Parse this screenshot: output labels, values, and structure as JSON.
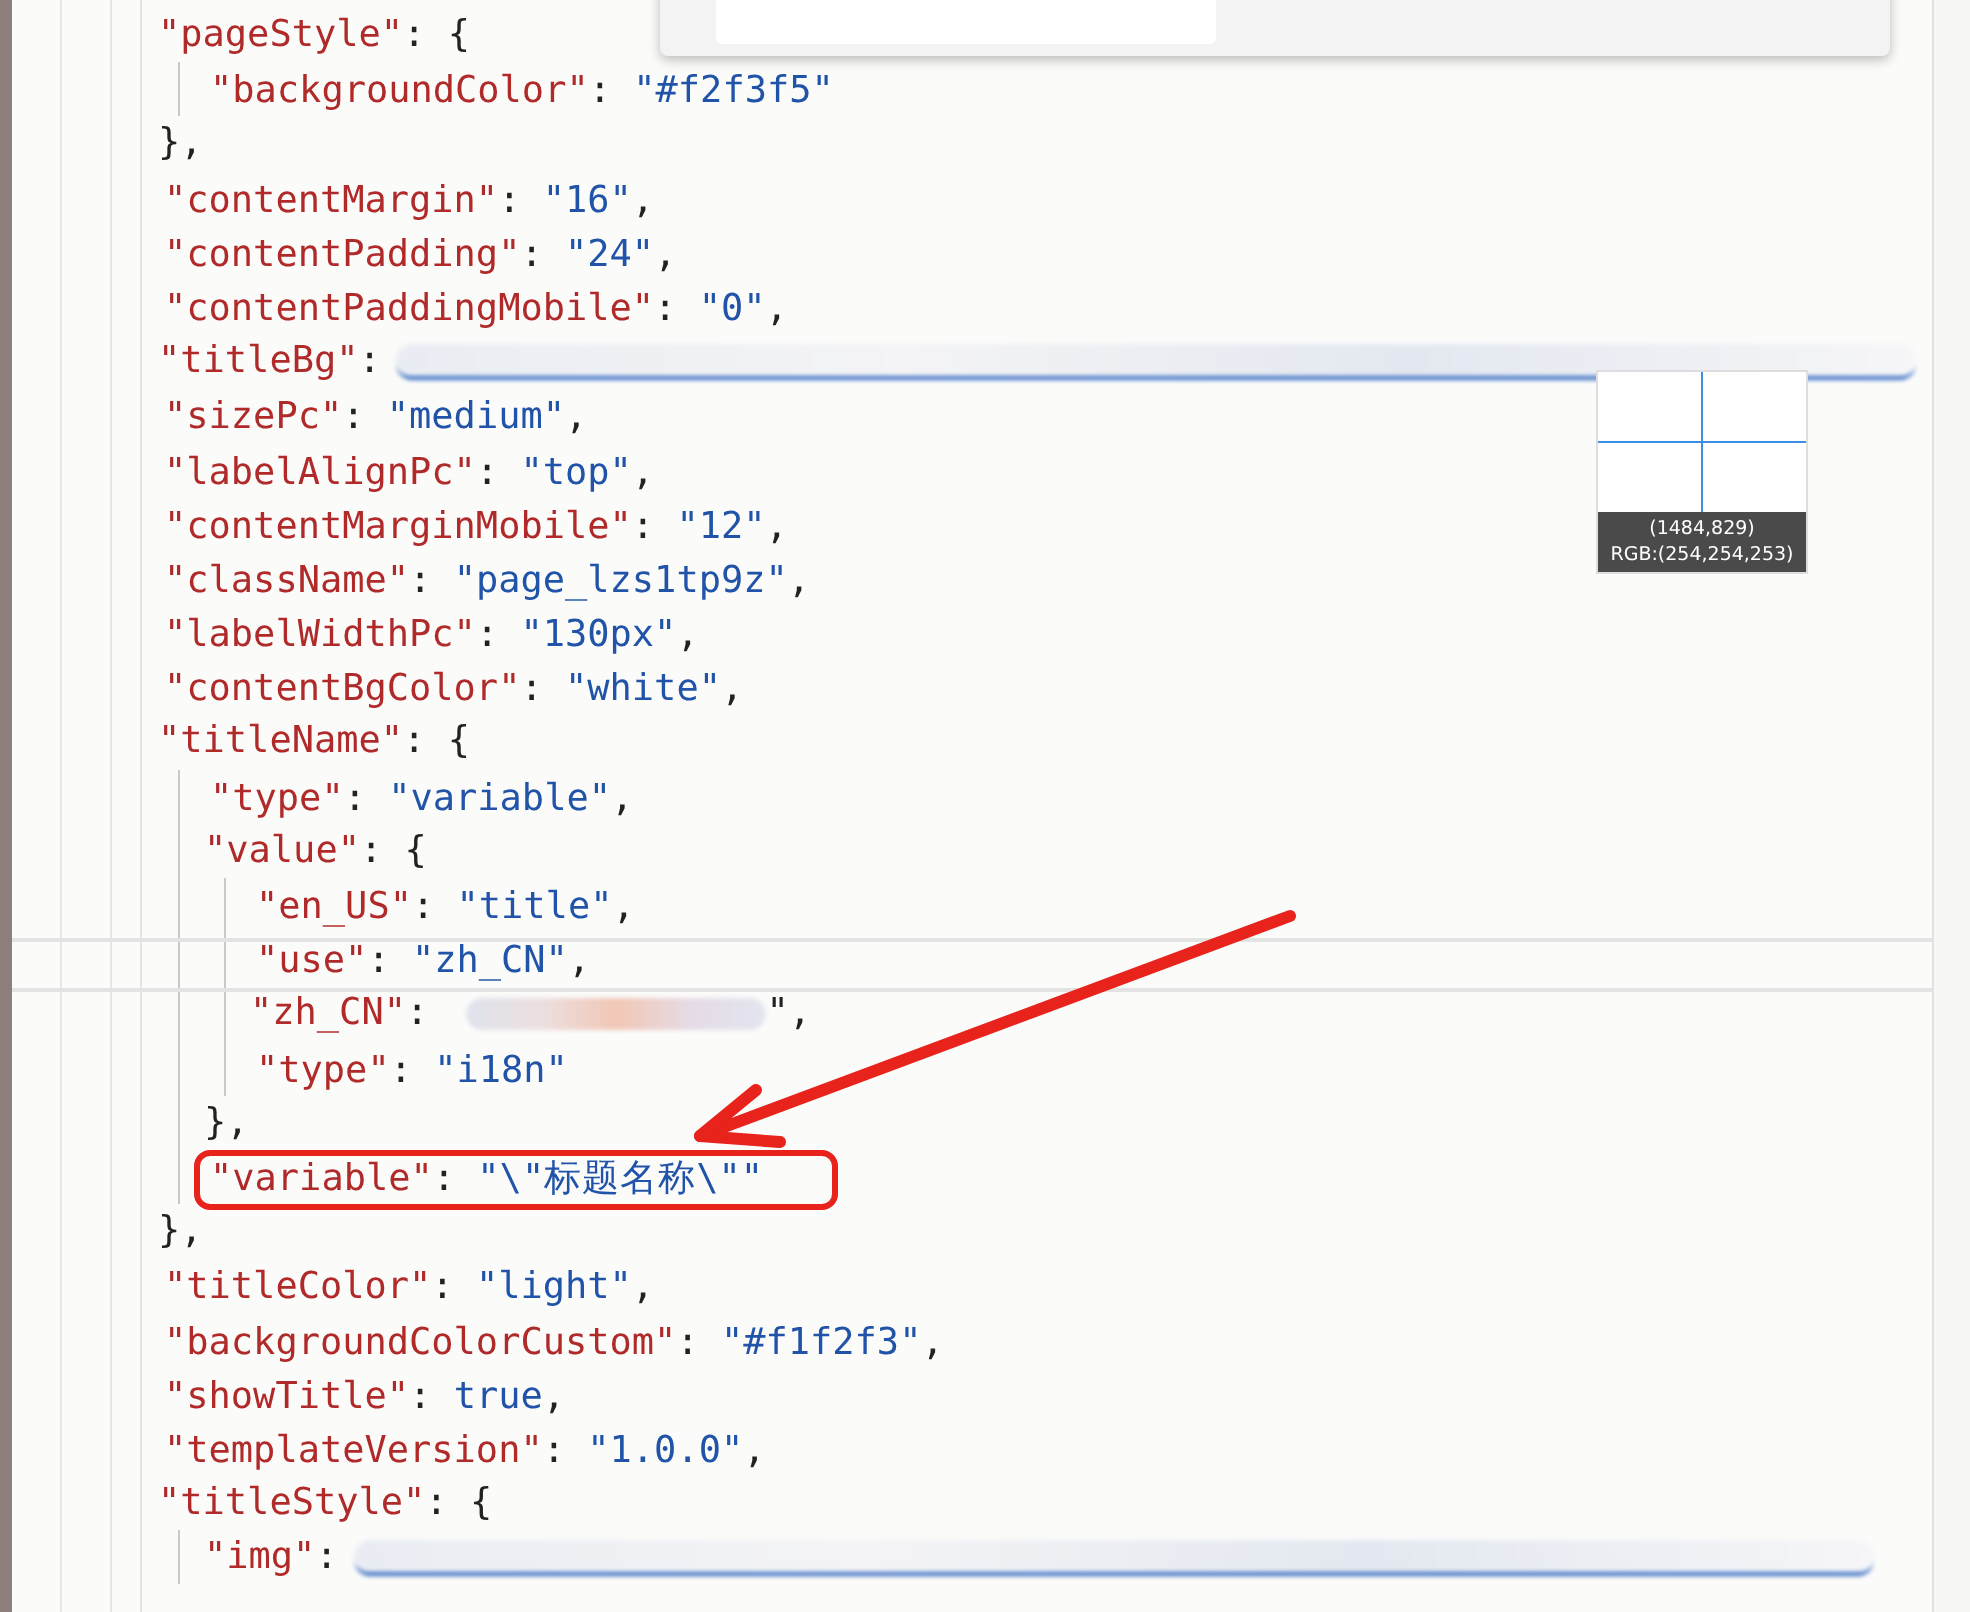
{
  "editor": {
    "lines": [
      {
        "kind": "object",
        "key": "\"pageStyle\"",
        "sep": ": ",
        "open": "{",
        "close": "},",
        "children": [
          {
            "kind": "pair",
            "key": "\"backgroundColor\"",
            "sep": ": ",
            "value": "\"#f2f3f5\""
          }
        ]
      },
      {
        "kind": "pair",
        "key": "\"contentMargin\"",
        "sep": ": ",
        "value": "\"16\"",
        "tail": ","
      },
      {
        "kind": "pair",
        "key": "\"contentPadding\"",
        "sep": ": ",
        "value": "\"24\"",
        "tail": ","
      },
      {
        "kind": "pair",
        "key": "\"contentPaddingMobile\"",
        "sep": ": ",
        "value": "\"0\"",
        "tail": ","
      },
      {
        "kind": "redacted",
        "key": "\"titleBg\"",
        "sep": ":",
        "link": true
      },
      {
        "kind": "pair",
        "key": "\"sizePc\"",
        "sep": ": ",
        "value": "\"medium\"",
        "tail": ","
      },
      {
        "kind": "pair",
        "key": "\"labelAlignPc\"",
        "sep": ": ",
        "value": "\"top\"",
        "tail": ","
      },
      {
        "kind": "pair",
        "key": "\"contentMarginMobile\"",
        "sep": ": ",
        "value": "\"12\"",
        "tail": ","
      },
      {
        "kind": "pair",
        "key": "\"className\"",
        "sep": ": ",
        "value": "\"page_lzs1tp9z\"",
        "tail": ","
      },
      {
        "kind": "pair",
        "key": "\"labelWidthPc\"",
        "sep": ": ",
        "value": "\"130px\"",
        "tail": ","
      },
      {
        "kind": "pair",
        "key": "\"contentBgColor\"",
        "sep": ": ",
        "value": "\"white\"",
        "tail": ","
      },
      {
        "kind": "object",
        "key": "\"titleName\"",
        "sep": ": ",
        "open": "{",
        "close": "},",
        "children": [
          {
            "kind": "pair",
            "key": "\"type\"",
            "sep": ": ",
            "value": "\"variable\"",
            "tail": ","
          },
          {
            "kind": "object",
            "key": "\"value\"",
            "sep": ": ",
            "open": "{",
            "close": "},",
            "children": [
              {
                "kind": "pair",
                "key": "\"en_US\"",
                "sep": ": ",
                "value": "\"title\"",
                "tail": ","
              },
              {
                "kind": "pair",
                "key": "\"use\"",
                "sep": ": ",
                "value": "\"zh_CN\"",
                "tail": ","
              },
              {
                "kind": "redacted",
                "key": "\"zh_CN\"",
                "sep": ": ",
                "link": false,
                "tail": "\","
              },
              {
                "kind": "pair",
                "key": "\"type\"",
                "sep": ": ",
                "value": "\"i18n\""
              }
            ]
          },
          {
            "kind": "pair",
            "key": "\"variable\"",
            "sep": ": ",
            "value": "\"\\\"标题名称\\\"\"",
            "highlighted": true
          }
        ]
      },
      {
        "kind": "pair",
        "key": "\"titleColor\"",
        "sep": ": ",
        "value": "\"light\"",
        "tail": ","
      },
      {
        "kind": "pair",
        "key": "\"backgroundColorCustom\"",
        "sep": ": ",
        "value": "\"#f1f2f3\"",
        "tail": ","
      },
      {
        "kind": "pair",
        "key": "\"showTitle\"",
        "sep": ": ",
        "value": "true",
        "tail": ","
      },
      {
        "kind": "pair",
        "key": "\"templateVersion\"",
        "sep": ": ",
        "value": "\"1.0.0\"",
        "tail": ","
      },
      {
        "kind": "object",
        "key": "\"titleStyle\"",
        "sep": ": ",
        "open": "{",
        "children": [
          {
            "kind": "redacted",
            "key": "\"img\"",
            "sep": ":",
            "link": true
          }
        ]
      }
    ]
  },
  "color_picker": {
    "coords": "(1484,829)",
    "rgb": "RGB:(254,254,253)"
  }
}
